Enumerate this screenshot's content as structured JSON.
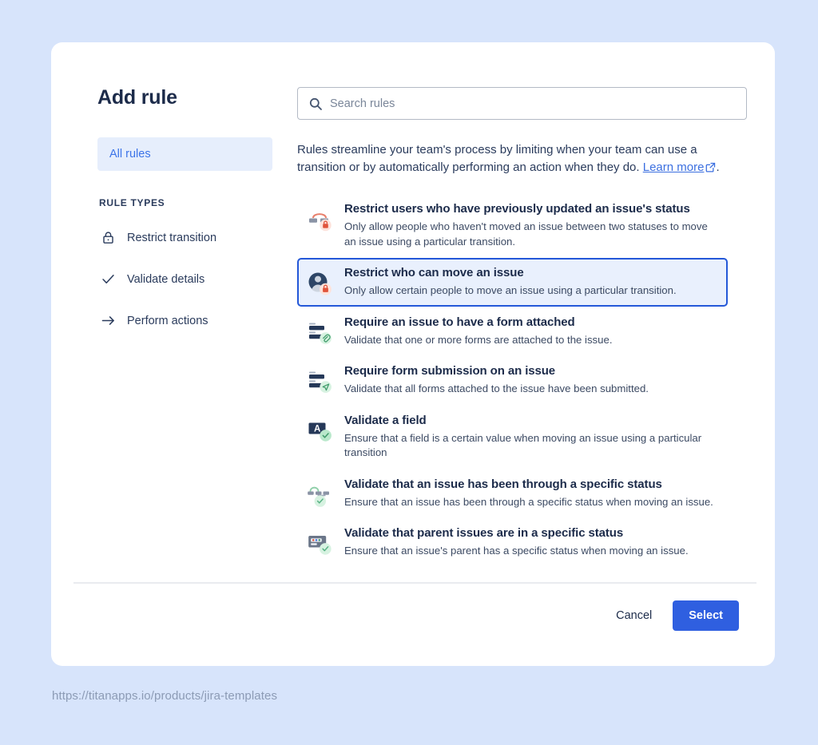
{
  "page": {
    "background_color": "#d7e4fb",
    "caption_url": "https://titanapps.io/products/jira-templates"
  },
  "dialog": {
    "title": "Add rule"
  },
  "sidebar": {
    "all_rules_label": "All rules",
    "section_label": "RULE TYPES",
    "items": [
      {
        "label": "Restrict transition",
        "icon": "lock-icon"
      },
      {
        "label": "Validate details",
        "icon": "check-icon"
      },
      {
        "label": "Perform actions",
        "icon": "arrow-right-icon"
      }
    ]
  },
  "search": {
    "placeholder": "Search rules",
    "value": "",
    "icon": "search-icon"
  },
  "intro": {
    "text_part1": "Rules streamline your team's process by limiting when your team can use a transition or by automatically performing an action when they do. ",
    "link_label": "Learn more",
    "link_icon": "external-link-icon",
    "text_part2": "."
  },
  "rules": [
    {
      "title": "Restrict users who have previously updated an issue's status",
      "description": "Only allow people who haven't moved an issue between two statuses to move an issue using a particular transition.",
      "icon": "transition-lock-icon",
      "selected": false
    },
    {
      "title": "Restrict who can move an issue",
      "description": "Only allow certain people to move an issue using a particular transition.",
      "icon": "person-lock-icon",
      "selected": true
    },
    {
      "title": "Require an issue to have a form attached",
      "description": "Validate that one or more forms are attached to the issue.",
      "icon": "form-attachment-icon",
      "selected": false
    },
    {
      "title": "Require form submission on an issue",
      "description": "Validate that all forms attached to the issue have been submitted.",
      "icon": "form-submit-icon",
      "selected": false
    },
    {
      "title": "Validate a field",
      "description": "Ensure that a field is a certain value when moving an issue using a particular transition",
      "icon": "field-check-icon",
      "selected": false
    },
    {
      "title": "Validate that an issue has been through a specific status",
      "description": "Ensure that an issue has been through a specific status when moving an issue.",
      "icon": "status-path-check-icon",
      "selected": false
    },
    {
      "title": "Validate that parent issues are in a specific status",
      "description": "Ensure that an issue's parent has a specific status when moving an issue.",
      "icon": "parent-status-check-icon",
      "selected": false
    }
  ],
  "footer": {
    "cancel_label": "Cancel",
    "select_label": "Select",
    "select_color": "#2f5fe0"
  }
}
